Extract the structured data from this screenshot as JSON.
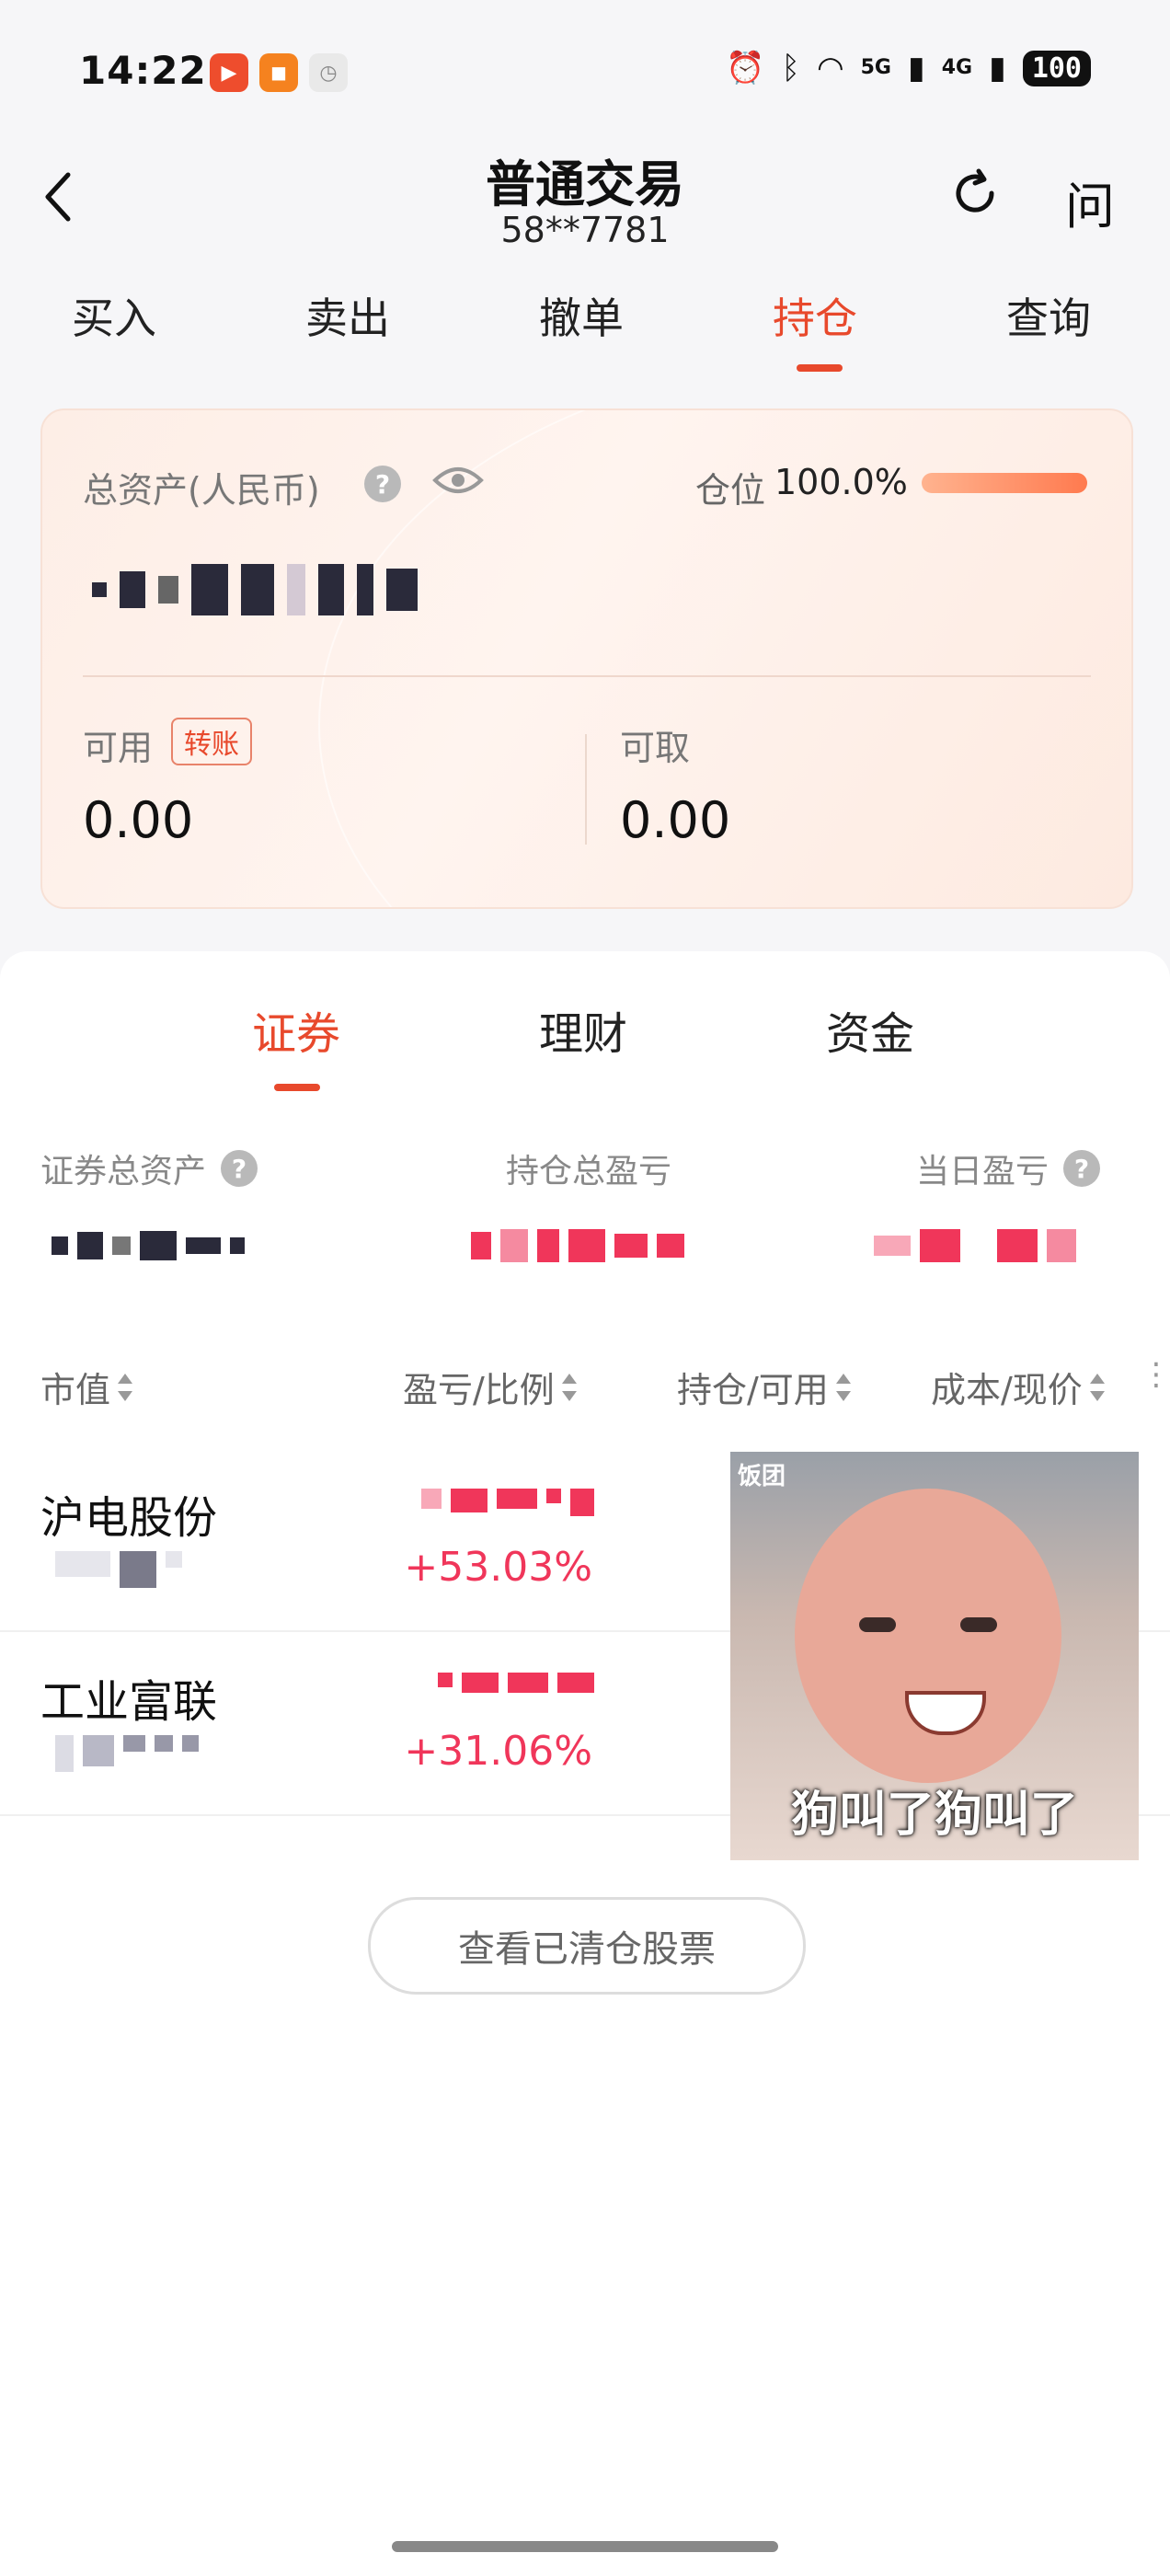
{
  "status_bar": {
    "time": "14:22",
    "net1": "5G",
    "net2": "4G",
    "battery": "100"
  },
  "header": {
    "title": "普通交易",
    "account": "58**7781",
    "ask_label": "问"
  },
  "top_tabs": [
    "买入",
    "卖出",
    "撤单",
    "持仓",
    "查询"
  ],
  "top_tabs_active": "持仓",
  "asset_card": {
    "total_label": "总资产(人民币)",
    "help": "?",
    "position_label": "仓位",
    "position_value": "100.0%",
    "position_fraction": 1.0,
    "available_label": "可用",
    "transfer_label": "转账",
    "available_value": "0.00",
    "withdrawable_label": "可取",
    "withdrawable_value": "0.00"
  },
  "sub_tabs": [
    "证券",
    "理财",
    "资金"
  ],
  "sub_tabs_active": "证券",
  "stats": {
    "securities_total_label": "证券总资产",
    "holding_pnl_label": "持仓总盈亏",
    "daily_pnl_label": "当日盈亏"
  },
  "columns": {
    "market_value": "市值",
    "pnl_ratio": "盈亏/比例",
    "holding_available": "持仓/可用",
    "cost_price": "成本/现价"
  },
  "holdings": [
    {
      "name": "沪电股份",
      "pnl_rate": "+53.03%"
    },
    {
      "name": "工业富联",
      "pnl_rate": "+31.06%"
    }
  ],
  "meme": {
    "tag": "饭团",
    "caption": "狗叫了狗叫了"
  },
  "cleared_button": "查看已清仓股票",
  "colors": {
    "accent": "#e8492c",
    "profit": "#f0365a"
  }
}
